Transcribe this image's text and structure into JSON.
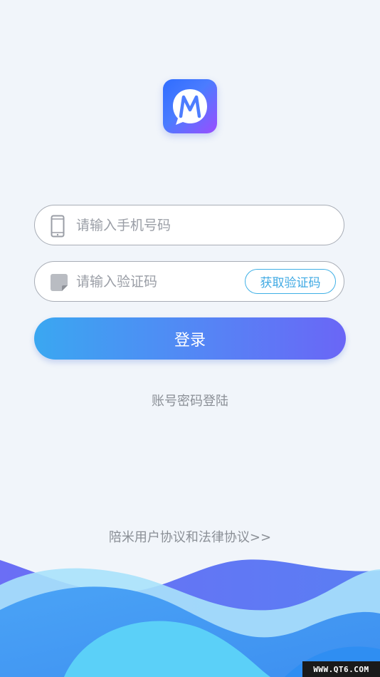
{
  "app": {
    "logo_icon": "m-logo-icon",
    "colors": {
      "background": "#f1f5fa",
      "primary_start": "#3aa7f1",
      "primary_end": "#6a66f6",
      "link": "#3fa9e3",
      "muted_text": "#8a8f96"
    }
  },
  "form": {
    "phone": {
      "placeholder": "请输入手机号码",
      "value": "",
      "icon": "phone-icon"
    },
    "code": {
      "placeholder": "请输入验证码",
      "value": "",
      "icon": "verify-code-icon",
      "get_code_label": "获取验证码"
    },
    "login_label": "登录"
  },
  "links": {
    "password_login": "账号密码登陆",
    "agreement": "陪米用户协议和法律协议>>"
  },
  "watermark": "WWW.QT6.COM"
}
